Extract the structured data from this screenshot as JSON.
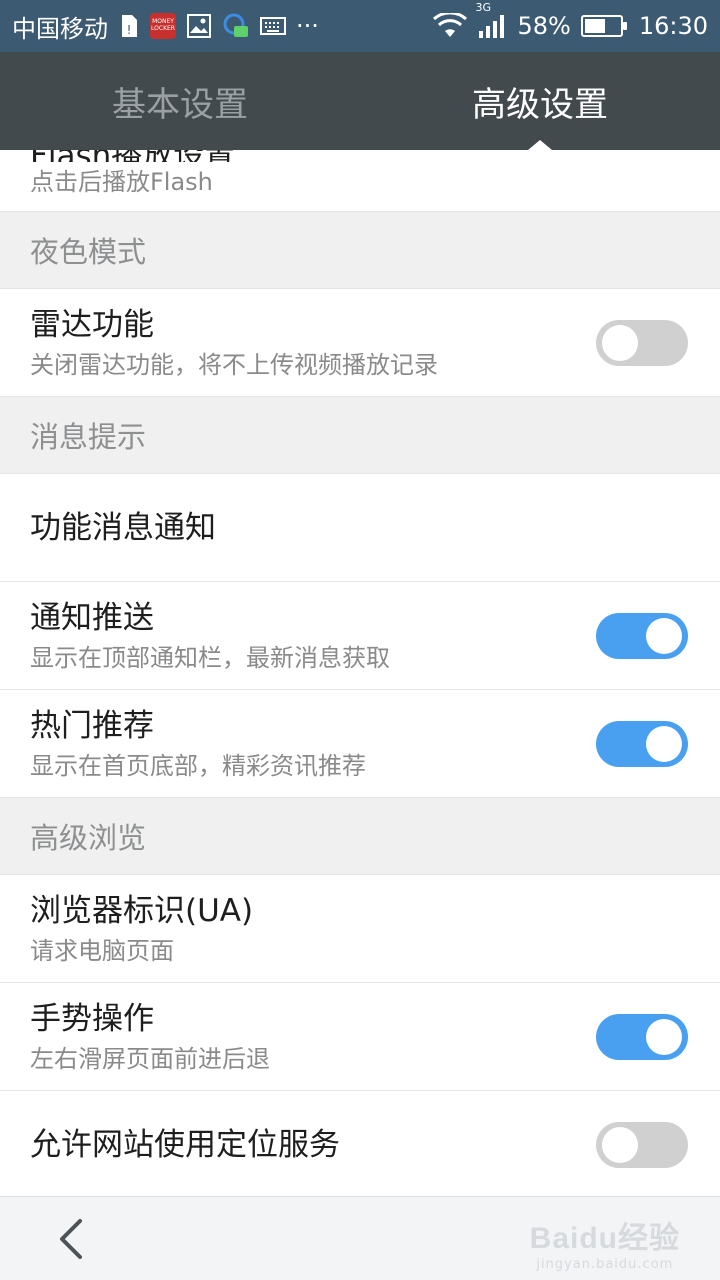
{
  "status_bar": {
    "carrier": "中国移动",
    "money_locker_label": "MONEY LOCKER",
    "network": "3G",
    "battery": "58%",
    "battery_level": 0.58,
    "time": "16:30",
    "more": "···"
  },
  "tabs": [
    {
      "label": "基本设置",
      "active": false
    },
    {
      "label": "高级设置",
      "active": true
    }
  ],
  "partial_item": {
    "title_fragment": "Flash播放设置",
    "subtitle": "点击后播放Flash"
  },
  "sections": [
    {
      "header": "夜色模式",
      "items": [
        {
          "title": "雷达功能",
          "subtitle": "关闭雷达功能，将不上传视频播放记录",
          "toggle": "off"
        }
      ]
    },
    {
      "header": "消息提示",
      "items": [
        {
          "title": "功能消息通知"
        },
        {
          "title": "通知推送",
          "subtitle": "显示在顶部通知栏，最新消息获取",
          "toggle": "on"
        },
        {
          "title": "热门推荐",
          "subtitle": "显示在首页底部，精彩资讯推荐",
          "toggle": "on"
        }
      ]
    },
    {
      "header": "高级浏览",
      "items": [
        {
          "title": "浏览器标识(UA)",
          "subtitle": "请求电脑页面"
        },
        {
          "title": "手势操作",
          "subtitle": "左右滑屏页面前进后退",
          "toggle": "on"
        },
        {
          "title": "允许网站使用定位服务",
          "toggle": "off"
        }
      ]
    }
  ],
  "bottom_bar": {
    "back_icon": "chevron-left-icon",
    "watermark_main": "Baidu经验",
    "watermark_sub": "jingyan.baidu.com"
  },
  "colors": {
    "status_bar": "#3d5a73",
    "tab_bar": "#434a4e",
    "toggle_on": "#4aa0f0",
    "toggle_off": "#d0d0d0",
    "section_bg": "#f0f0f0"
  }
}
